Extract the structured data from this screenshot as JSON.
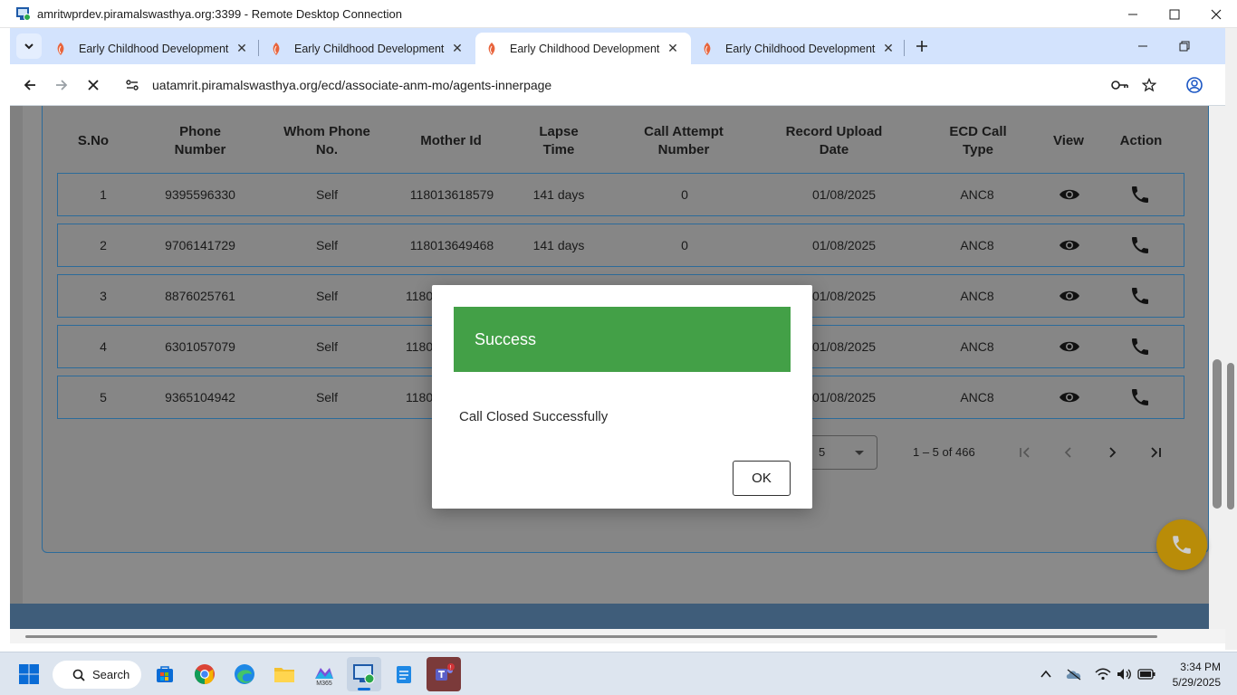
{
  "rdp": {
    "title": "amritwprdev.piramalswasthya.org:3399 - Remote Desktop Connection"
  },
  "browser": {
    "tabs": [
      {
        "title": "Early Childhood Development",
        "active": false
      },
      {
        "title": "Early Childhood Development",
        "active": false
      },
      {
        "title": "Early Childhood Development",
        "active": true
      },
      {
        "title": "Early Childhood Development",
        "active": false
      }
    ],
    "url": "uatamrit.piramalswasthya.org/ecd/associate-anm-mo/agents-innerpage"
  },
  "table": {
    "headers": [
      "S.No",
      "Phone Number",
      "Whom Phone No.",
      "Mother Id",
      "Lapse Time",
      "Call Attempt Number",
      "Record Upload Date",
      "ECD Call Type",
      "View",
      "Action"
    ],
    "rows": [
      {
        "sno": "1",
        "phone": "9395596330",
        "whom": "Self",
        "mother_id": "118013618579",
        "lapse": "141 days",
        "attempt": "0",
        "date": "01/08/2025",
        "type": "ANC8"
      },
      {
        "sno": "2",
        "phone": "9706141729",
        "whom": "Self",
        "mother_id": "118013649468",
        "lapse": "141 days",
        "attempt": "0",
        "date": "01/08/2025",
        "type": "ANC8"
      },
      {
        "sno": "3",
        "phone": "8876025761",
        "whom": "Self",
        "mother_id": "1180",
        "lapse": "",
        "attempt": "",
        "date": "01/08/2025",
        "type": "ANC8"
      },
      {
        "sno": "4",
        "phone": "6301057079",
        "whom": "Self",
        "mother_id": "1180",
        "lapse": "",
        "attempt": "",
        "date": "01/08/2025",
        "type": "ANC8"
      },
      {
        "sno": "5",
        "phone": "9365104942",
        "whom": "Self",
        "mother_id": "1180",
        "lapse": "",
        "attempt": "",
        "date": "01/08/2025",
        "type": "ANC8"
      }
    ]
  },
  "pagination": {
    "page_size": "5",
    "range": "1 – 5 of 466"
  },
  "dialog": {
    "title": "Success",
    "message": "Call Closed Successfully",
    "ok_label": "OK"
  },
  "taskbar": {
    "search_label": "Search",
    "time": "3:34 PM",
    "date": "5/29/2025",
    "m365_label": "M365"
  },
  "colors": {
    "success": "#43a047",
    "fab": "#b98c08",
    "tab_strip": "#d3e3fd"
  }
}
